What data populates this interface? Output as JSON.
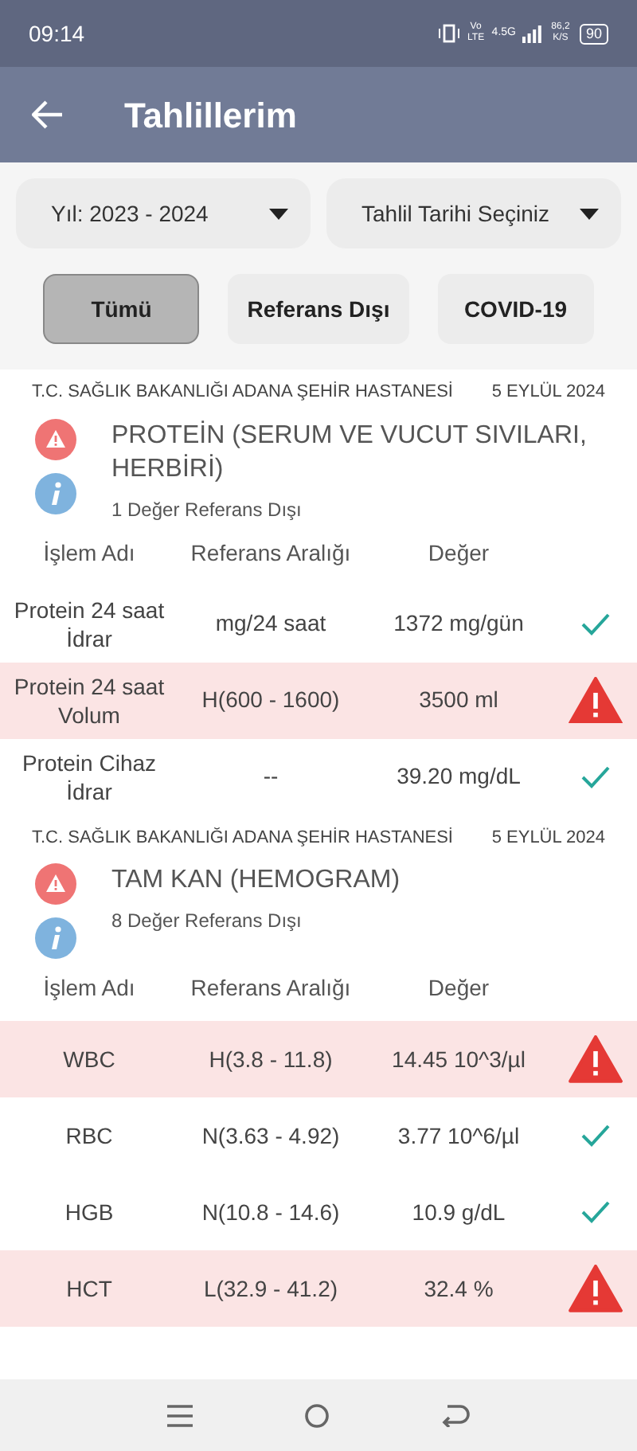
{
  "status_bar": {
    "time": "09:14",
    "volte": "Vo LTE",
    "network": "4.5G",
    "speed": "86,2 K/S",
    "battery": "90"
  },
  "header": {
    "title": "Tahlillerim"
  },
  "filters": [
    {
      "label": "Yıl: 2023 - 2024"
    },
    {
      "label": "Tahlil Tarihi Seçiniz"
    }
  ],
  "tabs": [
    {
      "label": "Tümü",
      "selected": true
    },
    {
      "label": "Referans Dışı",
      "selected": false
    },
    {
      "label": "COVID-19",
      "selected": false
    }
  ],
  "groups": [
    {
      "hospital": "T.C. SAĞLIK BAKANLIĞI ADANA ŞEHİR HASTANESİ",
      "date": "5 EYLÜL 2024",
      "title": "PROTEİN (SERUM VE VUCUT SIVILARI, HERBİRİ)",
      "summary": "1 Değer Referans Dışı",
      "columns": [
        "İşlem Adı",
        "Referans Aralığı",
        "Değer"
      ],
      "rows": [
        {
          "name": "Protein 24 saat İdrar",
          "range": "mg/24 saat",
          "value": "1372 mg/gün",
          "out_of_range": false
        },
        {
          "name": "Protein 24 saat Volum",
          "range": "H(600 - 1600)",
          "value": "3500 ml",
          "out_of_range": true
        },
        {
          "name": "Protein Cihaz İdrar",
          "range": "--",
          "value": "39.20 mg/dL",
          "out_of_range": false
        }
      ]
    },
    {
      "hospital": "T.C. SAĞLIK BAKANLIĞI ADANA ŞEHİR HASTANESİ",
      "date": "5 EYLÜL 2024",
      "title": "TAM KAN (HEMOGRAM)",
      "summary": "8 Değer Referans Dışı",
      "columns": [
        "İşlem Adı",
        "Referans Aralığı",
        "Değer"
      ],
      "rows": [
        {
          "name": "WBC",
          "range": "H(3.8 - 11.8)",
          "value": "14.45 10^3/µl",
          "out_of_range": true
        },
        {
          "name": "RBC",
          "range": "N(3.63 - 4.92)",
          "value": "3.77 10^6/µl",
          "out_of_range": false
        },
        {
          "name": "HGB",
          "range": "N(10.8 - 14.6)",
          "value": "10.9 g/dL",
          "out_of_range": false
        },
        {
          "name": "HCT",
          "range": "L(32.9 - 41.2)",
          "value": "32.4 %",
          "out_of_range": true
        }
      ]
    }
  ]
}
